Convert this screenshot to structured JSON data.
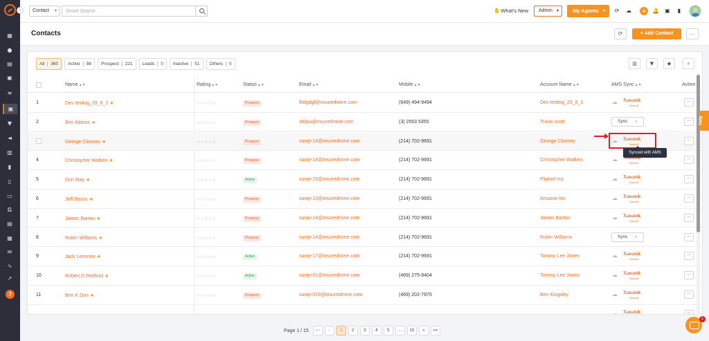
{
  "sidebar": {
    "icons": [
      "grid-icon",
      "user-icon",
      "document-icon",
      "calendar-icon",
      "list-icon",
      "contacts-icon",
      "funnel-icon",
      "megaphone-icon",
      "building-icon",
      "chart-icon",
      "clipboard-icon",
      "folder-icon",
      "google-icon",
      "notes-icon",
      "calendar-day-icon",
      "mail-icon",
      "signature-icon",
      "trend-icon",
      "settings-icon",
      "help-icon"
    ],
    "help_label": "?"
  },
  "topbar": {
    "search_type": "Contact",
    "search_placeholder": "Smart Search",
    "whats_new": "What's New",
    "admin_label": "Admin",
    "agents_label": "My Agents"
  },
  "page": {
    "title": "Contacts",
    "add_contact": "+ Add Contact",
    "more": "..."
  },
  "filters": [
    {
      "label": "All",
      "count": "360",
      "selected": true
    },
    {
      "label": "Active",
      "count": "88"
    },
    {
      "label": "Prospect",
      "count": "221"
    },
    {
      "label": "Leads",
      "count": "0"
    },
    {
      "label": "Inactive",
      "count": "51"
    },
    {
      "label": "Others",
      "count": "0"
    }
  ],
  "columns": {
    "name": "Name",
    "rating": "Rating",
    "status": "Status",
    "email": "Email",
    "mobile": "Mobile",
    "account": "Account Name",
    "ams": "AMS Sync",
    "action": "Action"
  },
  "rows": [
    {
      "idx": "1",
      "name": "Dev testing_29_8_1",
      "status": "Prospect",
      "email": "fbdgdgf@insuredmine.com",
      "mobile": "(649) 494-9494",
      "account": "Dev testing_29_8_1",
      "ams": "xanatek"
    },
    {
      "idx": "2",
      "name": "Ben Adams",
      "status": "Prospect",
      "email": "shilpa@insuredmine.com",
      "mobile": "(3) 2553 5355",
      "account": "Travis scott",
      "ams": "sync"
    },
    {
      "idx": "",
      "name": "George Clooney",
      "status": "Prospect",
      "email": "suraj+14@insuredmine.com",
      "mobile": "(214) 702-9691",
      "account": "George Clooney",
      "ams": "xanatek",
      "highlight": true
    },
    {
      "idx": "4",
      "name": "Christopher Walken",
      "status": "Prospect",
      "email": "suraj+14@insuredmine.com",
      "mobile": "(214) 702-9691",
      "account": "Christopher Walken",
      "ams": "xanatek"
    },
    {
      "idx": "5",
      "name": "Don May",
      "status": "Active",
      "email": "suraj+15@insuredmine.com",
      "mobile": "(214) 702-9691",
      "account": "Flipkart Inc",
      "ams": "xanatek"
    },
    {
      "idx": "6",
      "name": "Jeff Bezos",
      "status": "Prospect",
      "email": "suraj+13@insuredmine.com",
      "mobile": "(214) 702-9691",
      "account": "Amazon Inc",
      "ams": "xanatek"
    },
    {
      "idx": "7",
      "name": "James Barton",
      "status": "Prospect",
      "email": "suraj+14@insuredmine.com",
      "mobile": "(214) 702-9691",
      "account": "James Barton",
      "ams": "xanatek"
    },
    {
      "idx": "8",
      "name": "Robin Williams",
      "status": "Prospect",
      "email": "suraj+14@insuredmine.com",
      "mobile": "(214) 702-9691",
      "account": "Robin Williams",
      "ams": "sync"
    },
    {
      "idx": "9",
      "name": "Jack Lemmon",
      "status": "Active",
      "email": "suraj+17@insuredmine.com",
      "mobile": "(214) 702-9691",
      "account": "Tommy Lee Jones",
      "ams": "xanatek"
    },
    {
      "idx": "10",
      "name": "Robert D Redford",
      "status": "Active",
      "email": "suraj+01@insuredmine.com",
      "mobile": "(469) 275-9404",
      "account": "Tommy Lee Jones",
      "ams": "xanatek"
    },
    {
      "idx": "11",
      "name": "Ben K Don",
      "status": "Prospect",
      "email": "suraj+019@insuredmine.com",
      "mobile": "(469) 202-7870",
      "account": "Ben Kingsley",
      "ams": "xanatek"
    },
    {
      "idx": "",
      "name": "",
      "status": "",
      "email": "",
      "mobile": "",
      "account": "",
      "ams": "xanatek"
    }
  ],
  "ams_brand": {
    "name": "Xanatek",
    "sub": "Synced"
  },
  "sync_label": "Sync",
  "tooltip": "Synced with AMS",
  "help_tab": "Help",
  "pager": {
    "text": "Page 1 / 15",
    "first": "««",
    "prev": "‹",
    "pages": [
      "1",
      "2",
      "3",
      "4",
      "5",
      "...",
      "15"
    ],
    "current": "1",
    "next": "»",
    "last": "»»"
  },
  "chat_badge": "1",
  "colors": {
    "accent": "#f26c22",
    "brand_orange": "#f7931e",
    "sidebar": "#2c2f3a",
    "annotation": "#e31b23"
  }
}
